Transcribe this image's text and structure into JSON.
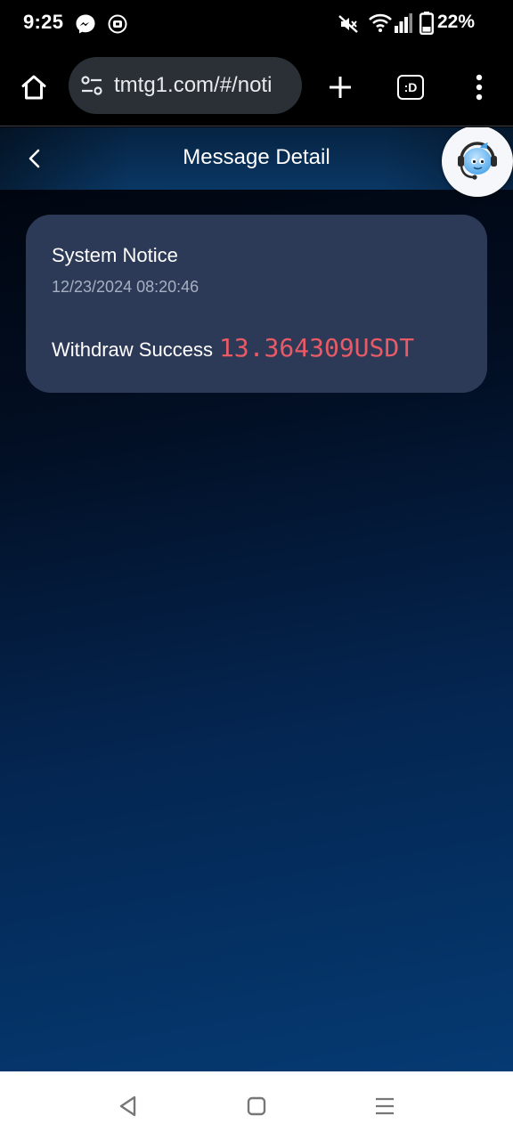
{
  "status_bar": {
    "time": "9:25",
    "battery_percent": "22%",
    "icons": [
      "messenger-icon",
      "notification-app-icon",
      "mute-icon",
      "wifi-icon",
      "signal-icon",
      "battery-icon"
    ]
  },
  "browser": {
    "url": "tmtg1.com/#/noti",
    "tab_count_label": ":D",
    "icons": [
      "home-icon",
      "site-settings-icon",
      "new-tab-icon",
      "tabs-icon",
      "more-menu-icon"
    ]
  },
  "page": {
    "title": "Message Detail",
    "icons": [
      "back-arrow-icon",
      "support-agent-icon"
    ]
  },
  "message": {
    "title": "System Notice",
    "date": "12/23/2024 08:20:46",
    "body_prefix": "Withdraw Success",
    "amount": "13.364309USDT",
    "amount_color": "#e85a66"
  },
  "colors": {
    "card_background": "#2d3a57",
    "page_gradient_top": "#00040c",
    "page_gradient_bottom": "#053a72"
  },
  "nav_bar": {
    "icons": [
      "back-nav-icon",
      "home-nav-icon",
      "recents-nav-icon"
    ]
  }
}
